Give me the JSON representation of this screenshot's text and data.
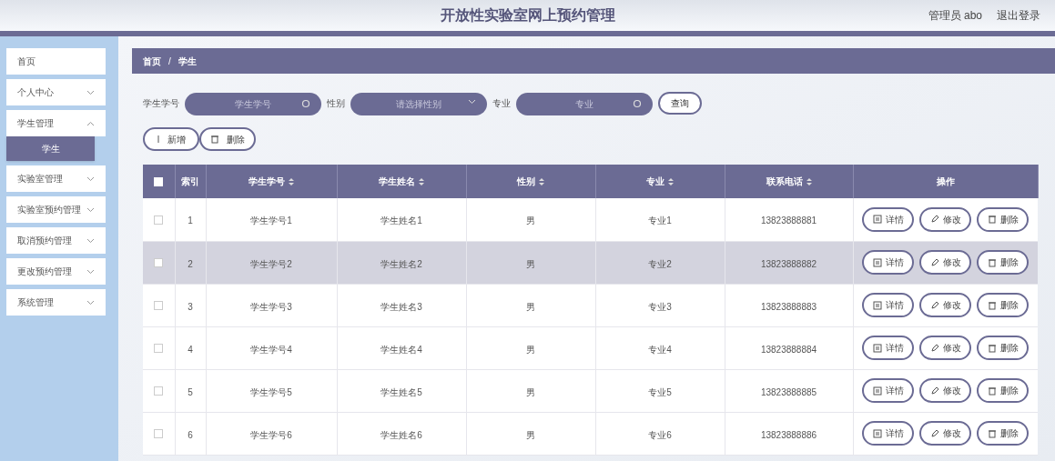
{
  "header": {
    "title": "开放性实验室网上预约管理",
    "user": "管理员 abo",
    "logout": "退出登录"
  },
  "sidebar": {
    "items": [
      {
        "kind": "link",
        "label": "首页"
      },
      {
        "kind": "menu",
        "label": "个人中心",
        "expanded": false
      },
      {
        "kind": "menu",
        "label": "学生管理",
        "expanded": true,
        "children": [
          {
            "label": "学生",
            "selected": true
          }
        ]
      },
      {
        "kind": "menu",
        "label": "实验室管理",
        "expanded": false
      },
      {
        "kind": "menu",
        "label": "实验室预约管理",
        "expanded": false
      },
      {
        "kind": "menu",
        "label": "取消预约管理",
        "expanded": false
      },
      {
        "kind": "menu",
        "label": "更改预约管理",
        "expanded": false
      },
      {
        "kind": "menu",
        "label": "系统管理",
        "expanded": false
      }
    ]
  },
  "breadcrumb": {
    "items": [
      "首页",
      "学生"
    ],
    "separator": "/"
  },
  "search": {
    "fields": [
      {
        "kind": "text",
        "label": "学生学号",
        "placeholder": "学生学号"
      },
      {
        "kind": "select",
        "label": "性别",
        "placeholder": "请选择性别"
      },
      {
        "kind": "text",
        "label": "专业",
        "placeholder": "专业"
      }
    ],
    "button": "查询"
  },
  "actions": [
    {
      "kind": "add",
      "label": "新增"
    },
    {
      "kind": "delete",
      "label": "删除"
    }
  ],
  "table": {
    "all_checked": false,
    "columns": [
      {
        "kind": "plain",
        "label": "索引"
      },
      {
        "kind": "sortable",
        "label": "学生学号"
      },
      {
        "kind": "sortable",
        "label": "学生姓名"
      },
      {
        "kind": "sortable",
        "label": "性别"
      },
      {
        "kind": "sortable",
        "label": "专业"
      },
      {
        "kind": "sortable",
        "label": "联系电话"
      },
      {
        "kind": "plain",
        "label": "操作"
      }
    ],
    "rows": [
      {
        "selected": false,
        "checked": false,
        "cells": [
          "1",
          "学生学号1",
          "学生姓名1",
          "男",
          "专业1",
          "13823888881"
        ],
        "buttons": [
          {
            "kind": "detail",
            "label": "详情"
          },
          {
            "kind": "edit",
            "label": "修改"
          },
          {
            "kind": "delete",
            "label": "删除"
          }
        ]
      },
      {
        "selected": true,
        "checked": false,
        "cells": [
          "2",
          "学生学号2",
          "学生姓名2",
          "男",
          "专业2",
          "13823888882"
        ],
        "buttons": [
          {
            "kind": "detail",
            "label": "详情"
          },
          {
            "kind": "edit",
            "label": "修改"
          },
          {
            "kind": "delete",
            "label": "删除"
          }
        ]
      },
      {
        "selected": false,
        "checked": false,
        "cells": [
          "3",
          "学生学号3",
          "学生姓名3",
          "男",
          "专业3",
          "13823888883"
        ],
        "buttons": [
          {
            "kind": "detail",
            "label": "详情"
          },
          {
            "kind": "edit",
            "label": "修改"
          },
          {
            "kind": "delete",
            "label": "删除"
          }
        ]
      },
      {
        "selected": false,
        "checked": false,
        "cells": [
          "4",
          "学生学号4",
          "学生姓名4",
          "男",
          "专业4",
          "13823888884"
        ],
        "buttons": [
          {
            "kind": "detail",
            "label": "详情"
          },
          {
            "kind": "edit",
            "label": "修改"
          },
          {
            "kind": "delete",
            "label": "删除"
          }
        ]
      },
      {
        "selected": false,
        "checked": false,
        "cells": [
          "5",
          "学生学号5",
          "学生姓名5",
          "男",
          "专业5",
          "13823888885"
        ],
        "buttons": [
          {
            "kind": "detail",
            "label": "详情"
          },
          {
            "kind": "edit",
            "label": "修改"
          },
          {
            "kind": "delete",
            "label": "删除"
          }
        ]
      },
      {
        "selected": false,
        "checked": false,
        "cells": [
          "6",
          "学生学号6",
          "学生姓名6",
          "男",
          "专业6",
          "13823888886"
        ],
        "buttons": [
          {
            "kind": "detail",
            "label": "详情"
          },
          {
            "kind": "edit",
            "label": "修改"
          },
          {
            "kind": "delete",
            "label": "删除"
          }
        ]
      }
    ]
  }
}
